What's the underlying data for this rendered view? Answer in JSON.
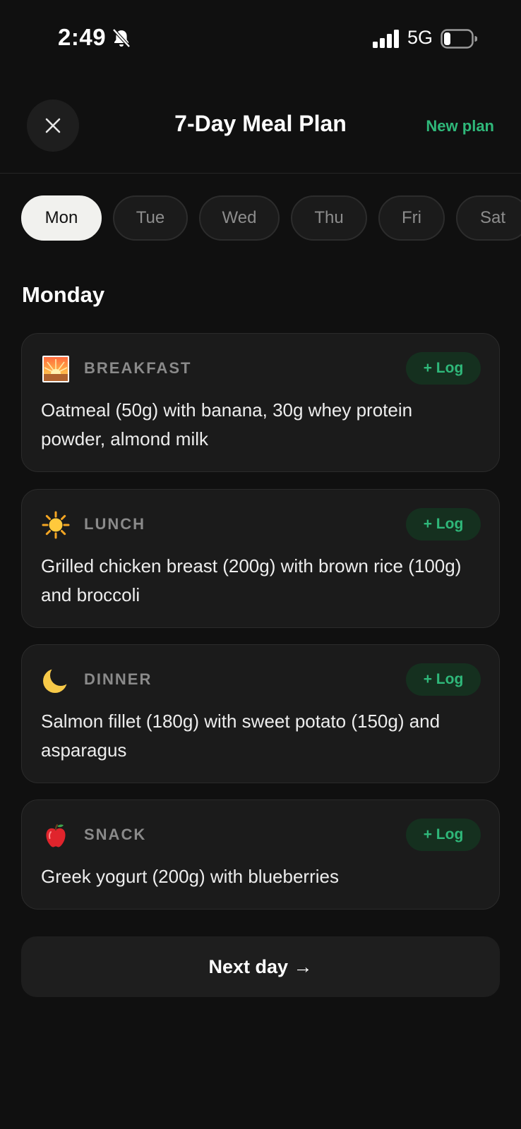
{
  "status": {
    "time": "2:49",
    "network": "5G"
  },
  "header": {
    "title": "7-Day Meal Plan",
    "new_plan_label": "New plan"
  },
  "days": [
    {
      "label": "Mon",
      "active": true
    },
    {
      "label": "Tue",
      "active": false
    },
    {
      "label": "Wed",
      "active": false
    },
    {
      "label": "Thu",
      "active": false
    },
    {
      "label": "Fri",
      "active": false
    },
    {
      "label": "Sat",
      "active": false
    }
  ],
  "day_heading": "Monday",
  "meals": [
    {
      "type": "BREAKFAST",
      "icon": "sunrise-icon",
      "log_label": "+ Log",
      "description": "Oatmeal (50g) with banana, 30g whey protein powder, almond milk"
    },
    {
      "type": "LUNCH",
      "icon": "sun-icon",
      "log_label": "+ Log",
      "description": "Grilled chicken breast (200g) with brown rice (100g) and broccoli"
    },
    {
      "type": "DINNER",
      "icon": "crescent-moon-icon",
      "log_label": "+ Log",
      "description": "Salmon fillet (180g) with sweet potato (150g) and asparagus"
    },
    {
      "type": "SNACK",
      "icon": "apple-icon",
      "log_label": "+ Log",
      "description": "Greek yogurt (200g) with blueberries"
    }
  ],
  "next_day_label": "Next day →",
  "colors": {
    "background": "#101010",
    "card": "#1b1b1b",
    "accent": "#2fb87a",
    "accent_bg": "#15301f",
    "active_tab": "#f1f1ee"
  }
}
